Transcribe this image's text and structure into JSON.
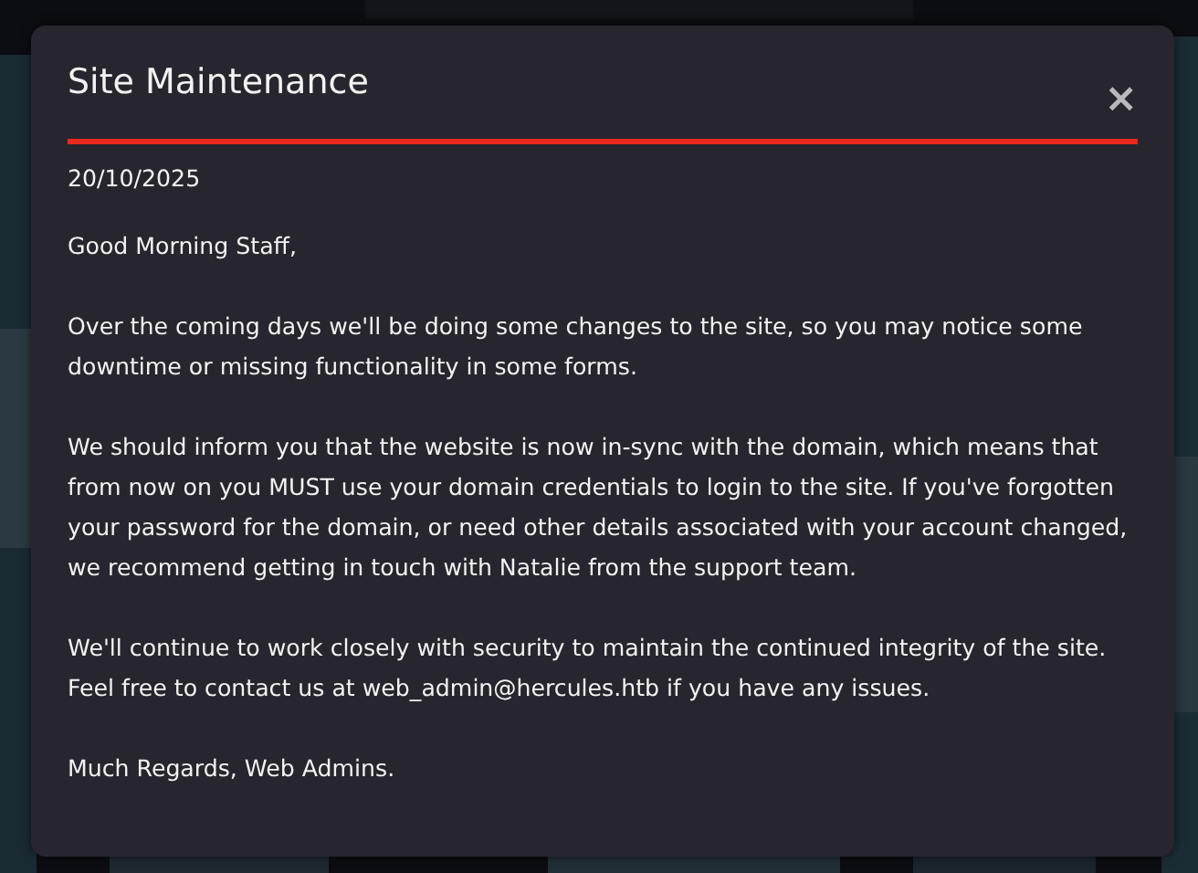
{
  "modal": {
    "title": "Site Maintenance",
    "close": "×",
    "date": "20/10/2025",
    "paragraphs": [
      "Good Morning Staff,",
      "Over the coming days we'll be doing some changes to the site, so you may notice some downtime or missing functionality in some forms.",
      "We should inform you that the website is now in-sync with the domain, which means that from now on you MUST use your domain credentials to login to the site. If you've forgotten your password for the domain, or need other details associated with your account changed, we recommend getting in touch with Natalie from the support team.",
      "We'll continue to work closely with security to maintain the continued integrity of the site. Feel free to contact us at web_admin@hercules.htb if you have any issues.",
      "Much Regards, Web Admins."
    ]
  }
}
